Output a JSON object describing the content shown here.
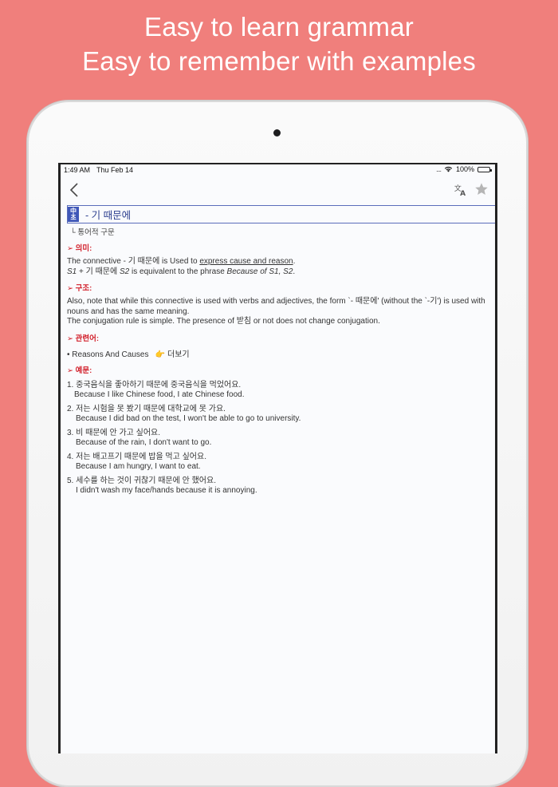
{
  "headline": {
    "line1": "Easy to learn grammar",
    "line2": "Easy to remember with examples"
  },
  "status_bar": {
    "time": "1:49 AM",
    "date": "Thu Feb 14",
    "signal": "....",
    "battery": "100%"
  },
  "colors": {
    "background": "#f07f7c",
    "accent_blue": "#3f57b8",
    "section_red": "#d2202b",
    "battery_green": "#3ac34c"
  },
  "nav": {
    "back_icon": "chevron-left-icon",
    "translate_icon": "translate-icon",
    "star_icon": "star-icon"
  },
  "entry": {
    "badge_top": "中",
    "badge_bottom": "초",
    "title": "- 기 때문에",
    "subtitle": "└ 통어적 구문",
    "meaning_label": "➢ 의미:",
    "meaning_line1_pre": "The connective - 기 때문에 is Used to ",
    "meaning_line1_link": "express cause and reason",
    "meaning_line1_post": ".",
    "meaning_line2_a": "S1",
    "meaning_line2_b": " + 기 때문에 ",
    "meaning_line2_c": "S2",
    "meaning_line2_d": "  is equivalent to the phrase ",
    "meaning_line2_e": "Because of S1, S2",
    "meaning_line2_f": ".",
    "structure_label": "➢ 구조:",
    "structure_text1": "Also, note that while this connective is used with verbs and adjectives, the form `- 때문에' (without the `-기') is used with nouns and has the same meaning.",
    "structure_text2": "The conjugation rule is simple. The presence of 받침 or not does not change conjugation.",
    "related_label": "➢ 관련어:",
    "related_item": "• Reasons And Causes",
    "related_more": "👉 더보기",
    "examples_label": "➢ 예문:",
    "examples": [
      {
        "ko": "1. 중국음식을 좋아하기 때문에 중국음식을 먹었어요.",
        "en": "Because I like Chinese food, I ate Chinese food."
      },
      {
        "ko": "2. 저는 시험을 못 봤기 때문에 대학교에 못 가요.",
        "en": "Because I did bad on the test, I won't be able to go to university."
      },
      {
        "ko": "3. 비 때문에 안 가고 싶어요.",
        "en": "Because of the rain, I don't want to go."
      },
      {
        "ko": "4. 저는 배고프기 때문에 밥을 먹고 싶어요.",
        "en": "Because I am hungry, I want to eat."
      },
      {
        "ko": "5. 세수를 하는 것이 귀찮기 때문에 안 했어요.",
        "en": "I didn't wash my face/hands because it is annoying."
      }
    ]
  }
}
